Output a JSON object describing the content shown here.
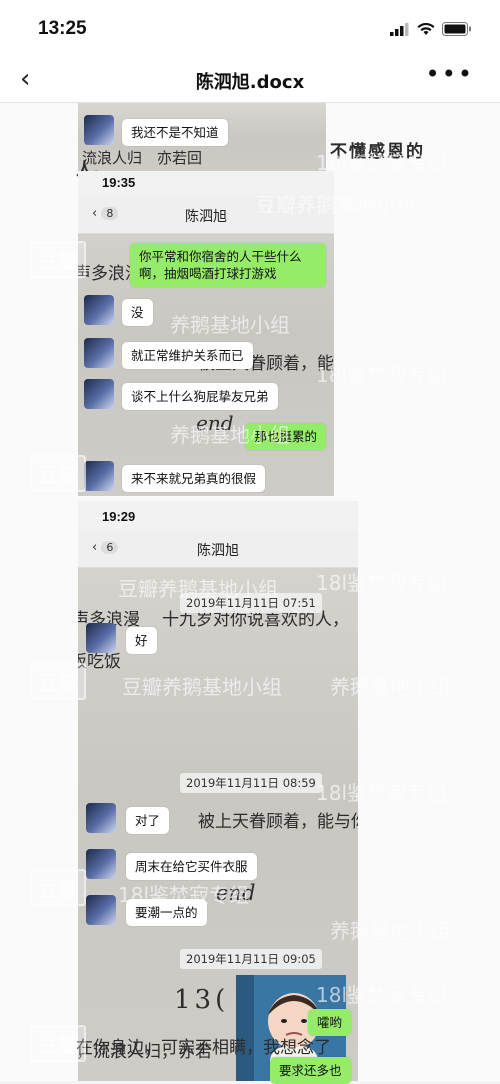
{
  "status": {
    "time": "13:25"
  },
  "nav": {
    "title": "陈泗旭.docx",
    "back": "‹",
    "more": "•••"
  },
  "book_fragments": {
    "top_right": "不懂感恩的",
    "top_left": "人。",
    "frag1": "声多浪漫",
    "frag2": "被上天眷顾着，能与你每天",
    "frag3": "end",
    "frag4": "十九岁对你说喜欢的人，",
    "frag5": "饭吃饭",
    "frag6": "13(",
    "frag7": "，流浪人归，亦若",
    "frag8": "在你身边，可实不相瞒，我想念了",
    "frag9": "流浪人归　亦若回"
  },
  "shot1": {
    "first_msg": "我还不是不知道"
  },
  "shot2": {
    "time": "19:35",
    "back_count": "8",
    "title": "陈泗旭",
    "messages": [
      {
        "side": "me",
        "text": "你平常和你宿舍的人干些什么啊，抽烟喝酒打球打游戏"
      },
      {
        "side": "them",
        "text": "没"
      },
      {
        "side": "them",
        "text": "就正常维护关系而已"
      },
      {
        "side": "them",
        "text": "谈不上什么狗屁挚友兄弟"
      },
      {
        "side": "me",
        "text": "那也挺累的"
      },
      {
        "side": "them",
        "text": "来不来就兄弟真的很假"
      }
    ]
  },
  "shot3": {
    "time": "19:29",
    "back_count": "6",
    "title": "陈泗旭",
    "timestamps": [
      "2019年11月11日 07:51",
      "2019年11月11日 08:59",
      "2019年11月11日 09:05"
    ],
    "messages": [
      {
        "side": "them",
        "text": "好"
      },
      {
        "side": "them",
        "text": "对了"
      },
      {
        "side": "them",
        "text": "周末在给它买件衣服"
      },
      {
        "side": "them",
        "text": "要潮一点的"
      },
      {
        "side": "me",
        "text": "嚯哟"
      },
      {
        "side": "me",
        "text": "要求还多也"
      }
    ]
  },
  "watermarks": {
    "brand": "豆瓣",
    "group_a": "18l鉴焚寂专组",
    "group_b": "豆瓣养鹅基地小组",
    "group_c": "养鹅基地小组"
  },
  "icons": {
    "signal": "signal-icon",
    "wifi": "wifi-icon",
    "battery": "battery-icon",
    "back": "back-chevron-icon",
    "more": "more-icon"
  },
  "colors": {
    "bubble_me": "#95ec69",
    "bubble_them": "#ffffff"
  }
}
